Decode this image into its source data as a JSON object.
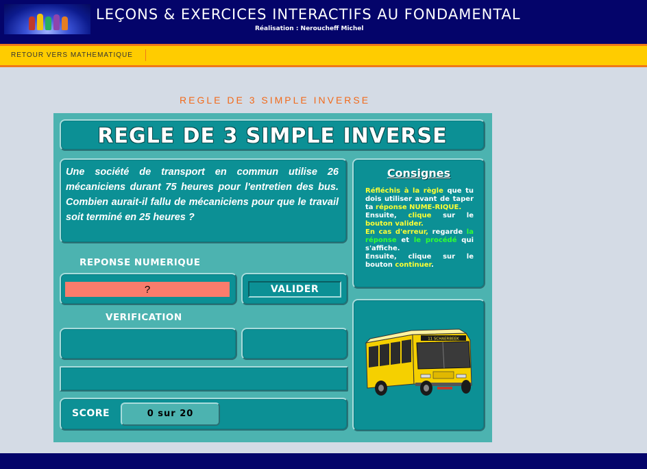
{
  "header": {
    "title": "LEÇONS & EXERCICES INTERACTIFS AU FONDAMENTAL",
    "subtitle": "Réalisation : Neroucheff Michel"
  },
  "nav": {
    "back_link": "RETOUR VERS MATHEMATIQUE"
  },
  "page": {
    "heading": "REGLE DE 3 SIMPLE INVERSE"
  },
  "exercise": {
    "banner": "REGLE DE 3 SIMPLE INVERSE",
    "question": "Une société de transport en commun utilise 26 mécaniciens durant 75 heures pour l'entretien des bus. Combien aurait-il fallu de mécaniciens pour que le travail soit terminé en 25 heures ?",
    "response_label": "REPONSE NUMERIQUE",
    "answer_value": "?",
    "validate_label": "VALIDER",
    "verification_label": "VERIFICATION",
    "score_label": "SCORE",
    "score_value": "0  sur 20",
    "bus_sign": "11 SCHAERBEEK"
  },
  "instructions": {
    "title": "Consignes",
    "p1_hl": "Réfléchis à la règle",
    "p1_a": " que tu dois utiliser avant de taper ta ",
    "p1_hl2": "réponse NUME-RIQUE.",
    "p2_a": "Ensuite, ",
    "p2_hl": "clique",
    "p2_b": " sur le ",
    "p2_hl2": "bouton valider.",
    "p3_hl": "En cas d'erreur,",
    "p3_a": " regarde ",
    "p3_hl2": "la réponse",
    "p3_b": " et ",
    "p3_hl3": "le procédé",
    "p3_c": " qui s'affiche.",
    "p4_a": "Ensuite, clique sur le bouton ",
    "p4_hl": "continuer",
    "p4_b": "."
  },
  "colors": {
    "header_bg": "#04046a",
    "nav_bg": "#ffcc00",
    "nav_border": "#f07818",
    "heading_orange": "#f26a1a",
    "panel_bg": "#4cb3b0",
    "box_teal": "#0c9095",
    "answer_field": "#fa7c6c",
    "highlight_yellow": "#ffff33",
    "highlight_green": "#33ff33",
    "bus_yellow": "#f5d000"
  },
  "icons": {
    "logo": "kids-logo-image",
    "bus": "bus-illustration"
  }
}
